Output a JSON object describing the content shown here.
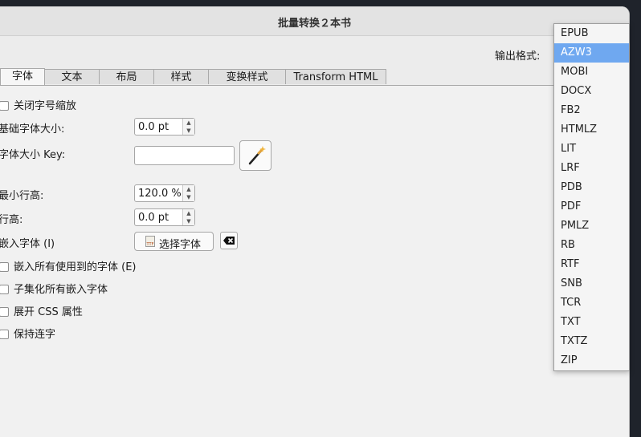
{
  "window": {
    "title": "批量转换２本书"
  },
  "output": {
    "label": "输出格式:"
  },
  "tabs": [
    "字体",
    "文本",
    "布局",
    "样式",
    "变换样式",
    "Transform HTML"
  ],
  "form": {
    "disable_font_scaling": "关闭字号缩放",
    "base_font_size_label": "基础字体大小:",
    "base_font_size_value": "0.0 pt",
    "font_size_key_label": "字体大小 Key:",
    "font_size_key_value": "",
    "min_line_height_label": "最小行高:",
    "min_line_height_value": "120.0 %",
    "line_height_label": "行高:",
    "line_height_value": "0.0 pt",
    "embed_font_label": "嵌入字体 (I)",
    "choose_font_button": "选择字体",
    "embed_all_fonts": "嵌入所有使用到的字体 (E)",
    "subset_fonts": "子集化所有嵌入字体",
    "expand_css": "展开 CSS 属性",
    "keep_ligatures": "保持连字"
  },
  "formats": {
    "selected": "AZW3",
    "options": [
      "EPUB",
      "AZW3",
      "MOBI",
      "DOCX",
      "FB2",
      "HTMLZ",
      "LIT",
      "LRF",
      "PDB",
      "PDF",
      "PMLZ",
      "RB",
      "RTF",
      "SNB",
      "TCR",
      "TXT",
      "TXTZ",
      "ZIP"
    ]
  },
  "colors": {
    "selection": "#6fa8f0",
    "desktop": "#1f232b"
  }
}
